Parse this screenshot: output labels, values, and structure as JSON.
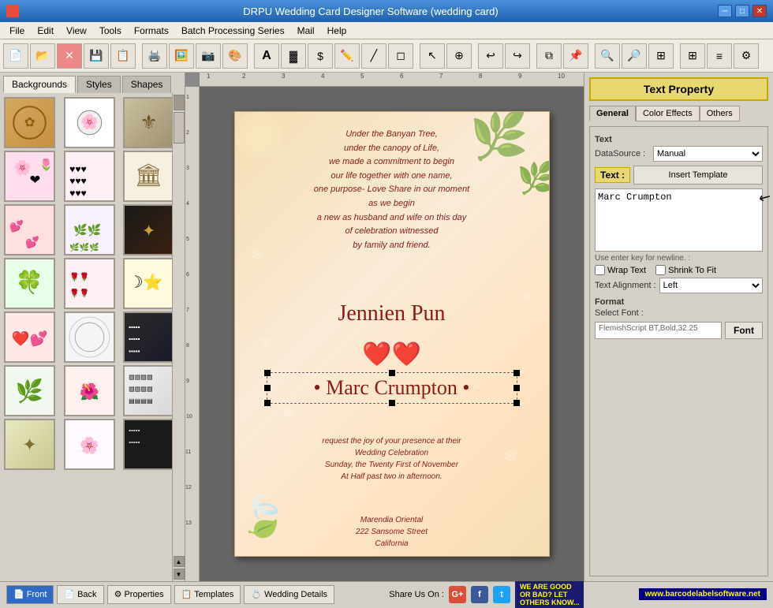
{
  "titlebar": {
    "title": "DRPU Wedding Card Designer Software (wedding card)",
    "app_icon": "💒"
  },
  "menubar": {
    "items": [
      "File",
      "Edit",
      "View",
      "Tools",
      "Formats",
      "Batch Processing Series",
      "Mail",
      "Help"
    ]
  },
  "left_panel": {
    "tabs": [
      "Backgrounds",
      "Styles",
      "Shapes"
    ],
    "active_tab": "Backgrounds"
  },
  "right_panel": {
    "title": "Text Property",
    "prop_tabs": [
      "General",
      "Color Effects",
      "Others"
    ],
    "active_prop_tab": "General",
    "datasource_label": "DataSource :",
    "datasource_value": "Manual",
    "text_label": "Text :",
    "insert_template_label": "Insert Template",
    "text_content": "Marc Crumpton",
    "hint": "Use enter key for newline. :",
    "wrap_text_label": "Wrap Text",
    "shrink_to_fit_label": "Shrink To Fit",
    "text_alignment_label": "Text Alignment :",
    "alignment_value": "Left",
    "format_label": "Format",
    "select_font_label": "Select Font :",
    "font_value": "FlemishScript BT,Bold,32.25",
    "font_btn_label": "Font"
  },
  "card": {
    "text_block1": "Under the Banyan Tree,\nunder the canopy of Life,\nwe made a commitment to begin\nour life together with one name,\none purpose- Love Share in our moment\nas we begin\na new as husband and wife on this day\nof celebration witnessed\nby family and friend.",
    "name1": "Jennien Pun",
    "hearts": "❤️❤️",
    "name2": "• Marc Crumpton •",
    "invite_text": "request the joy of your presence at their\nWedding Celebration\nSunday, the Twenty First of November\nAt Half past two in afternoon.",
    "address": "Marendia Oriental\n222 Sansome Street\nCalifornia"
  },
  "bottom_bar": {
    "buttons": [
      "Front",
      "Back",
      "Properties",
      "Templates",
      "Wedding Details"
    ],
    "active_button": "Front",
    "share_label": "Share Us On :",
    "brand_text": "WE ARE GOOD\nOR BAD? LET\nOTHERS KNOW...",
    "website": "www.barcodelabelsoftware.net"
  }
}
